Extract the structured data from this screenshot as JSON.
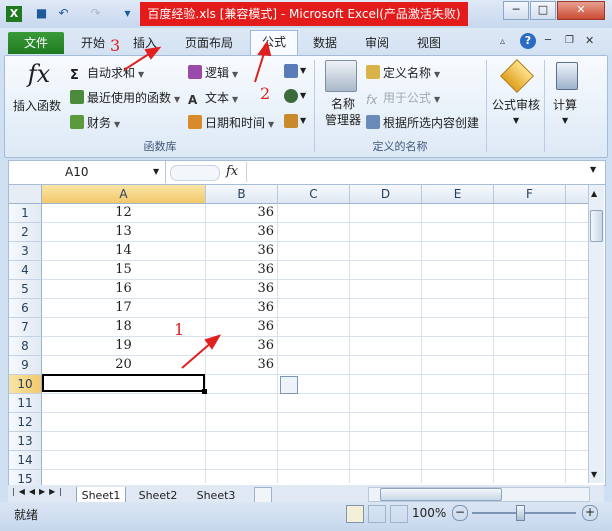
{
  "window": {
    "title": "百度经验.xls  [兼容模式]  -  Microsoft Excel(产品激活失败)"
  },
  "window_buttons": [
    "─",
    "□",
    "✕"
  ],
  "quick_access": {
    "save_icon": "save-icon",
    "undo_icon": "undo-icon",
    "redo_icon": "redo-icon"
  },
  "tabs": [
    "文件",
    "开始",
    "插入",
    "页面布局",
    "公式",
    "数据",
    "审阅",
    "视图"
  ],
  "ribbon": {
    "insert_function": "插入函数",
    "autosum": "自动求和",
    "recent": "最近使用的函数",
    "finance": "财务",
    "logic": "逻辑",
    "text": "文本",
    "datetime": "日期和时间",
    "group_library": "函数库",
    "name_manager": "名称\n管理器",
    "name_manager_1": "名称",
    "name_manager_2": "管理器",
    "define_name": "定义名称",
    "use_in_formula": "用于公式",
    "create_from_selection": "根据所选内容创建",
    "group_names": "定义的名称",
    "audit": "公式审核",
    "calc": "计算"
  },
  "formula_bar": {
    "name_box": "A10",
    "fx": "fx",
    "value": ""
  },
  "columns": [
    "A",
    "B",
    "C",
    "D",
    "E",
    "F"
  ],
  "rows": [
    "1",
    "2",
    "3",
    "4",
    "5",
    "6",
    "7",
    "8",
    "9",
    "10",
    "11",
    "12",
    "13",
    "14",
    "15"
  ],
  "cells": {
    "A": [
      "12",
      "13",
      "14",
      "15",
      "16",
      "17",
      "18",
      "19",
      "20"
    ],
    "B": [
      "36",
      "36",
      "36",
      "36",
      "36",
      "36",
      "36",
      "36",
      "36"
    ]
  },
  "active_cell": "A10",
  "sheets": [
    "Sheet1",
    "Sheet2",
    "Sheet3"
  ],
  "status": {
    "ready": "就绪",
    "zoom": "100%"
  },
  "annotations": {
    "n1": "1",
    "n2": "2",
    "n3": "3"
  },
  "colors": {
    "accent": "#1f7a1f",
    "title_highlight": "#e31b1b",
    "annotation": "#e02020",
    "selection": "#000000"
  }
}
